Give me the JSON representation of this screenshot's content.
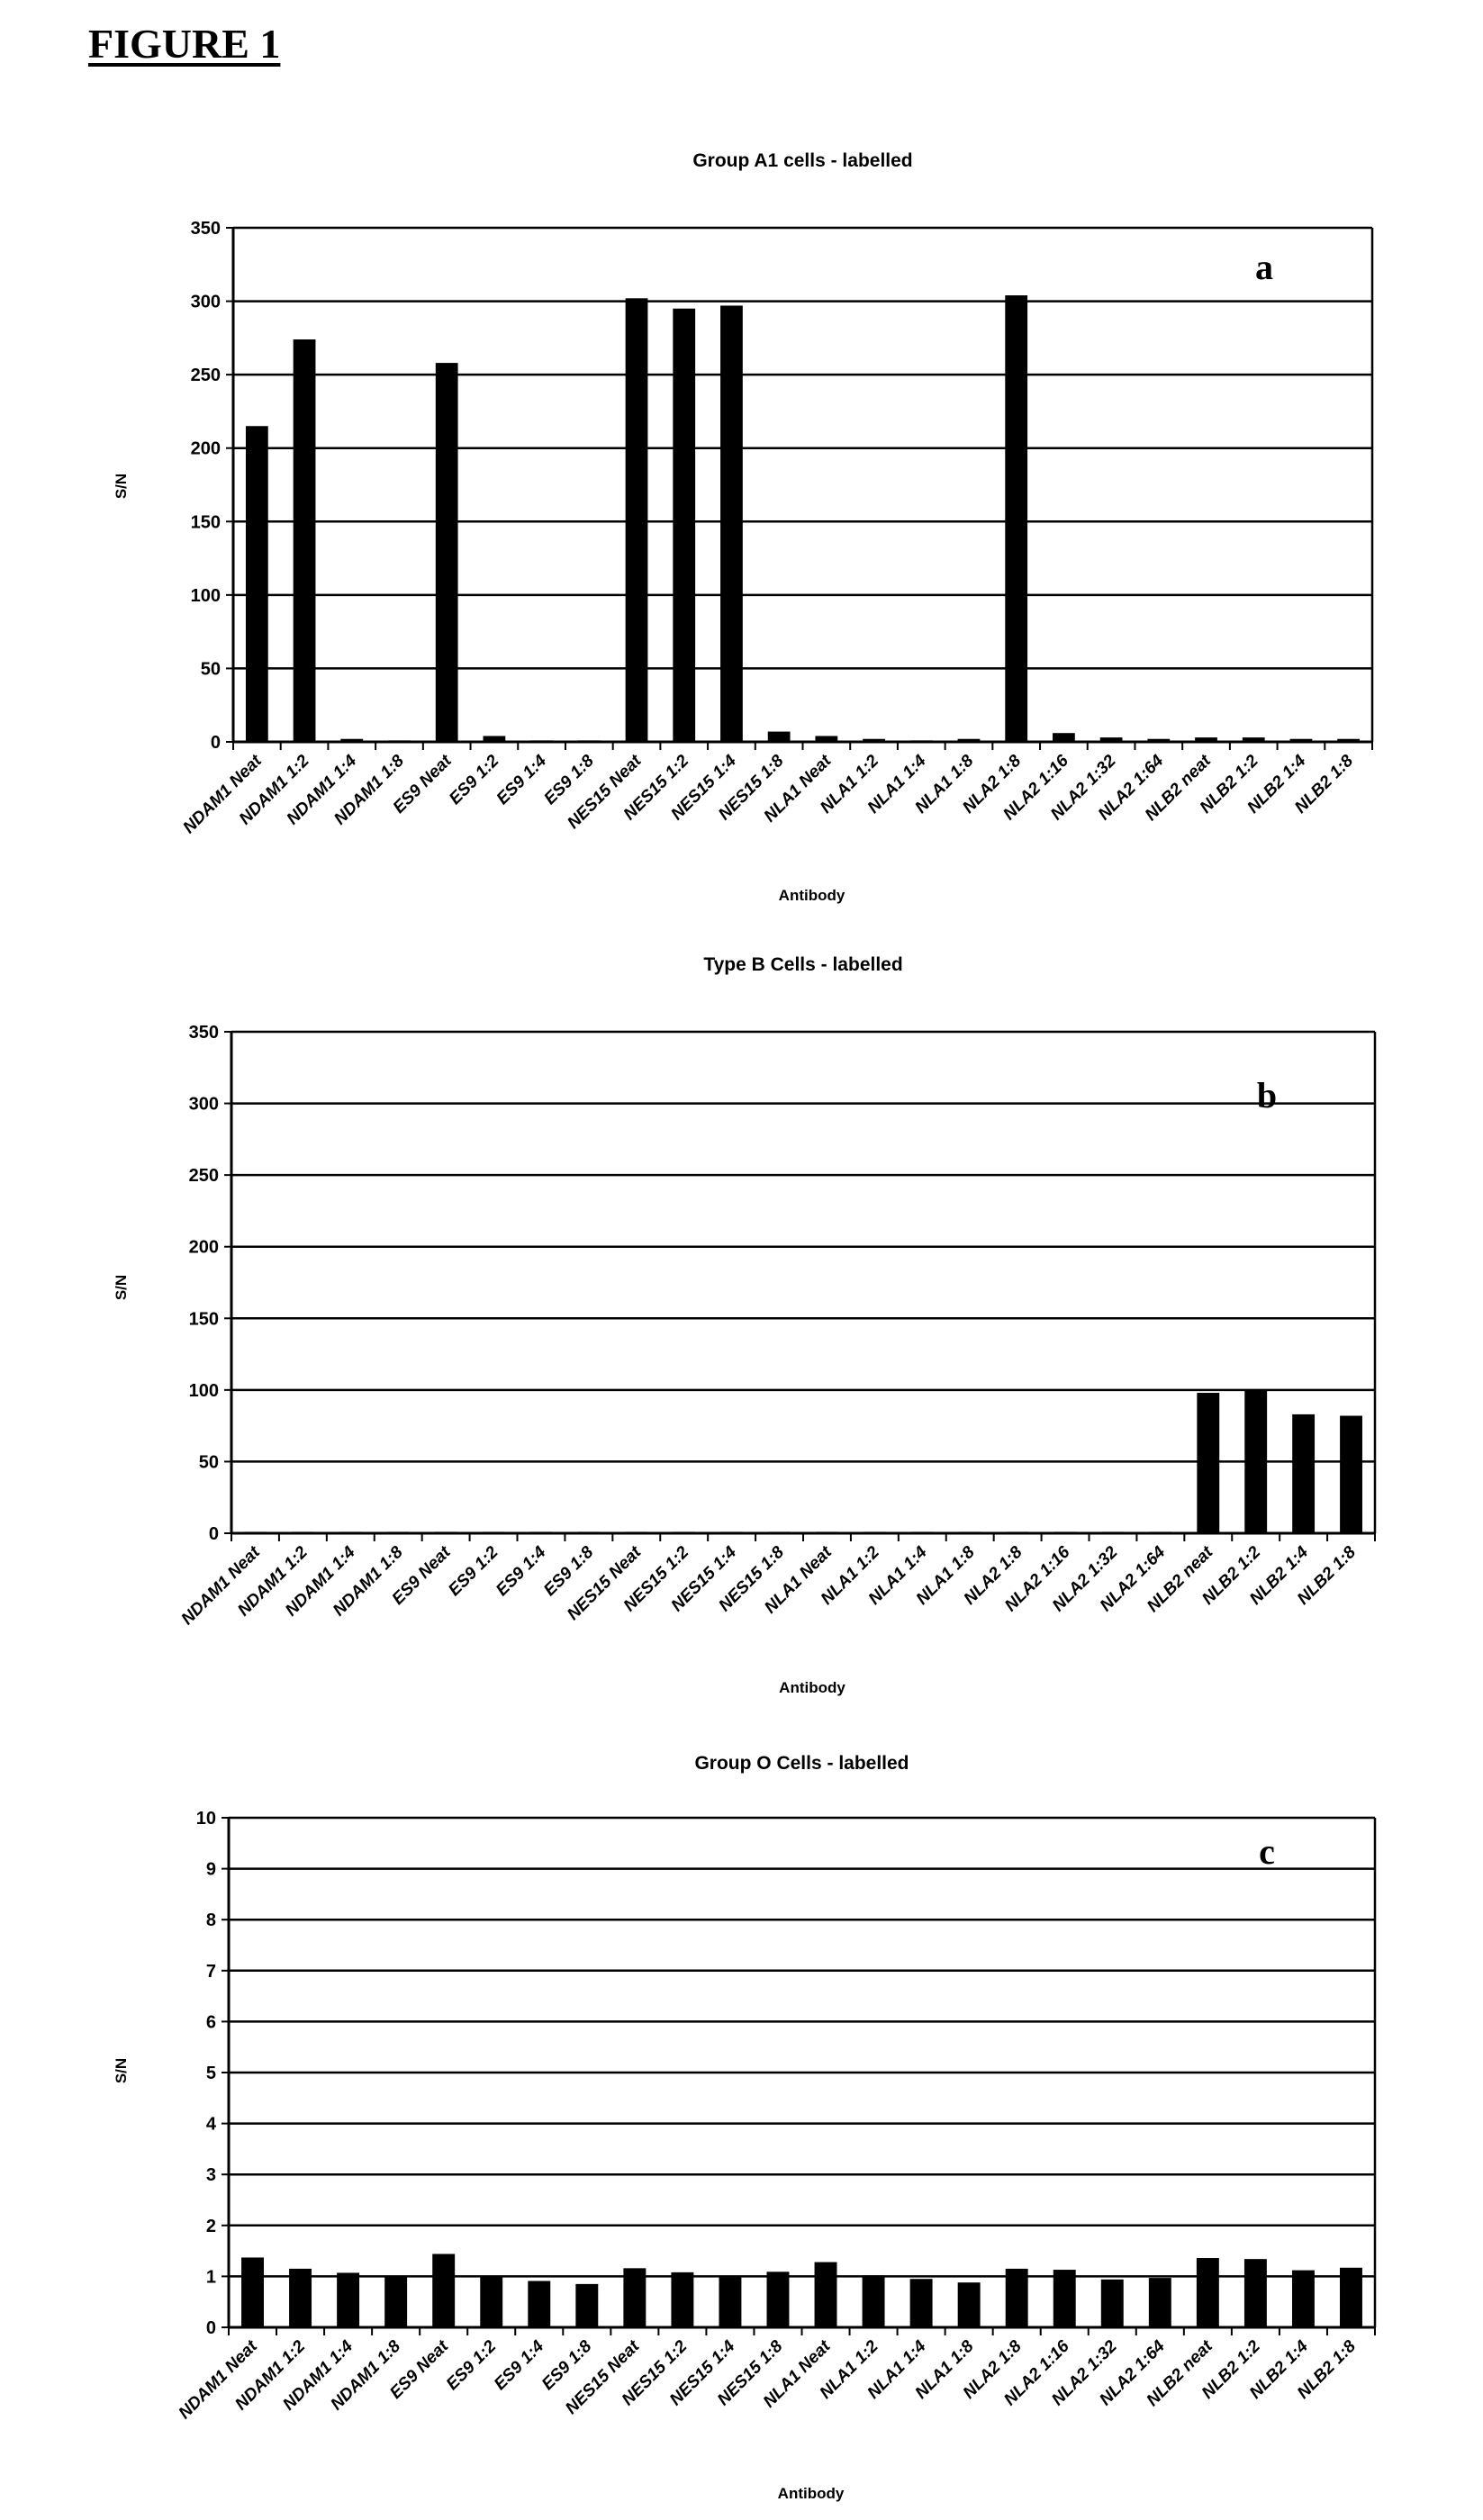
{
  "figure_title": "FIGURE 1",
  "chart_data": [
    {
      "type": "bar",
      "panel": "a",
      "title": "Group A1 cells - labelled",
      "xlabel": "Antibody",
      "ylabel": "S/N",
      "ylim": [
        0,
        350
      ],
      "yticks": [
        0,
        50,
        100,
        150,
        200,
        250,
        300,
        350
      ],
      "grid": true,
      "categories": [
        "NDAM1 Neat",
        "NDAM1 1:2",
        "NDAM1 1:4",
        "NDAM1 1:8",
        "ES9 Neat",
        "ES9 1:2",
        "ES9 1:4",
        "ES9 1:8",
        "NES15 Neat",
        "NES15 1:2",
        "NES15 1:4",
        "NES15 1:8",
        "NLA1 Neat",
        "NLA1 1:2",
        "NLA1 1:4",
        "NLA1 1:8",
        "NLA2 1:8",
        "NLA2 1:16",
        "NLA2 1:32",
        "NLA2 1:64",
        "NLB2 neat",
        "NLB2 1:2",
        "NLB2 1:4",
        "NLB2 1:8"
      ],
      "values": [
        215,
        274,
        2,
        1,
        258,
        4,
        1,
        1,
        302,
        295,
        297,
        7,
        4,
        2,
        1,
        2,
        304,
        6,
        3,
        2,
        3,
        3,
        2,
        2
      ]
    },
    {
      "type": "bar",
      "panel": "b",
      "title": "Type B Cells - labelled",
      "xlabel": "Antibody",
      "ylabel": "S/N",
      "ylim": [
        0,
        350
      ],
      "yticks": [
        0,
        50,
        100,
        150,
        200,
        250,
        300,
        350
      ],
      "grid": true,
      "categories": [
        "NDAM1 Neat",
        "NDAM1 1:2",
        "NDAM1 1:4",
        "NDAM1 1:8",
        "ES9 Neat",
        "ES9 1:2",
        "ES9 1:4",
        "ES9 1:8",
        "NES15 Neat",
        "NES15 1:2",
        "NES15 1:4",
        "NES15 1:8",
        "NLA1 Neat",
        "NLA1 1:2",
        "NLA1 1:4",
        "NLA1 1:8",
        "NLA2 1:8",
        "NLA2 1:16",
        "NLA2 1:32",
        "NLA2 1:64",
        "NLB2 neat",
        "NLB2 1:2",
        "NLB2 1:4",
        "NLB2 1:8"
      ],
      "values": [
        1,
        1,
        1,
        1,
        1,
        1,
        1,
        1,
        1,
        1,
        1,
        1,
        1,
        1,
        1,
        1,
        1,
        1,
        1,
        1,
        98,
        100,
        83,
        82
      ]
    },
    {
      "type": "bar",
      "panel": "c",
      "title": "Group O Cells - labelled",
      "xlabel": "Antibody",
      "ylabel": "S/N",
      "ylim": [
        0,
        10
      ],
      "yticks": [
        0,
        1,
        2,
        3,
        4,
        5,
        6,
        7,
        8,
        9,
        10
      ],
      "grid": true,
      "categories": [
        "NDAM1 Neat",
        "NDAM1 1:2",
        "NDAM1 1:4",
        "NDAM1 1:8",
        "ES9 Neat",
        "ES9 1:2",
        "ES9 1:4",
        "ES9 1:8",
        "NES15 Neat",
        "NES15 1:2",
        "NES15 1:4",
        "NES15 1:8",
        "NLA1 Neat",
        "NLA1 1:2",
        "NLA1 1:4",
        "NLA1 1:8",
        "NLA2 1:8",
        "NLA2 1:16",
        "NLA2 1:32",
        "NLA2 1:64",
        "NLB2 neat",
        "NLB2 1:2",
        "NLB2 1:4",
        "NLB2 1:8"
      ],
      "values": [
        1.37,
        1.15,
        1.07,
        1.0,
        1.44,
        1.0,
        0.91,
        0.85,
        1.16,
        1.08,
        0.98,
        1.09,
        1.28,
        1.02,
        0.95,
        0.88,
        1.15,
        1.13,
        0.94,
        0.97,
        1.36,
        1.34,
        1.12,
        1.17
      ]
    }
  ]
}
